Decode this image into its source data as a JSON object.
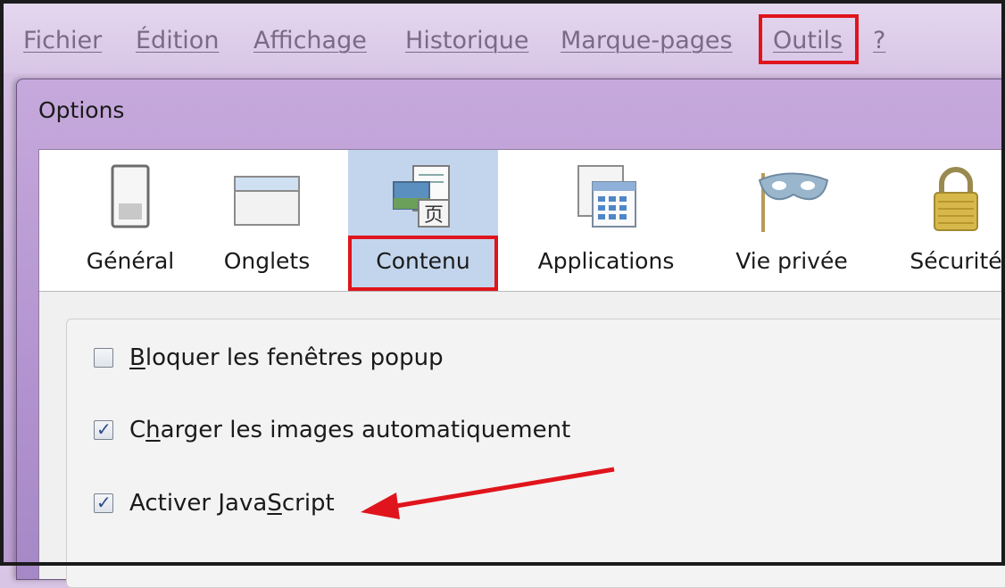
{
  "menubar": {
    "items": [
      {
        "pre": "",
        "u": "F",
        "post": "ichier"
      },
      {
        "pre": "Éditio",
        "u": "n",
        "post": ""
      },
      {
        "pre": "",
        "u": "A",
        "post": "ffichage"
      },
      {
        "pre": "",
        "u": "H",
        "post": "istorique"
      },
      {
        "pre": "",
        "u": "M",
        "post": "arque-pages"
      },
      {
        "pre": "",
        "u": "O",
        "post": "utils"
      },
      {
        "pre": "",
        "u": "?",
        "post": ""
      }
    ]
  },
  "dialog": {
    "title": "Options",
    "tabs": [
      {
        "label": "Général",
        "icon": "general-icon"
      },
      {
        "label": "Onglets",
        "icon": "tabs-folder-icon"
      },
      {
        "label": "Contenu",
        "icon": "content-icon"
      },
      {
        "label": "Applications",
        "icon": "applications-icon"
      },
      {
        "label": "Vie privée",
        "icon": "privacy-mask-icon"
      },
      {
        "label": "Sécurité",
        "icon": "security-lock-icon"
      }
    ],
    "selected_tab": "Contenu",
    "options": [
      {
        "pre": "",
        "u": "B",
        "post": "loquer les fenêtres popup",
        "checked": false
      },
      {
        "pre": "C",
        "u": "h",
        "post": "arger les images automatiquement",
        "checked": true
      },
      {
        "pre": "Activer Java",
        "u": "S",
        "post": "cript",
        "checked": true
      }
    ]
  },
  "colors": {
    "highlight": "#e0141c",
    "selected_tab": "#c3d5ec",
    "menu_text": "#7a6a88"
  }
}
